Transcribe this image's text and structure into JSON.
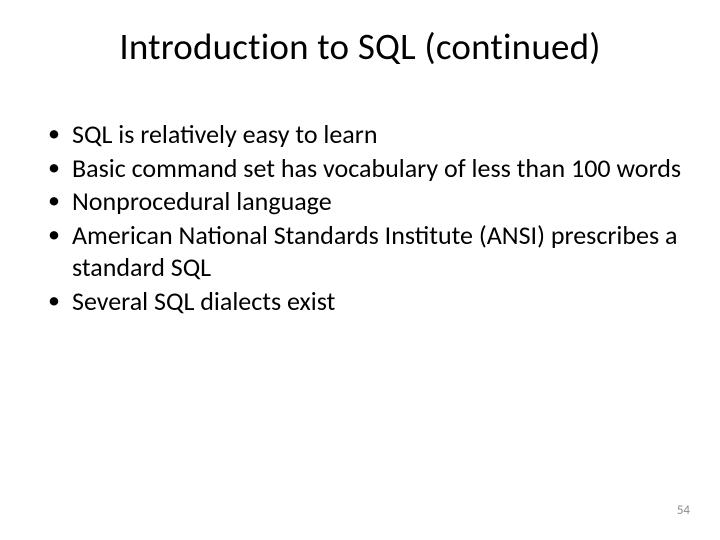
{
  "title": "Introduction to SQL (continued)",
  "bullets": {
    "i0": "SQL is relatively easy to learn",
    "i1": "Basic command set has vocabulary of less than 100 words",
    "i2": "Nonprocedural language",
    "i3": "American National Standards Institute (ANSI) prescribes a standard SQL",
    "i4": "Several SQL dialects exist"
  },
  "page_number": "54"
}
